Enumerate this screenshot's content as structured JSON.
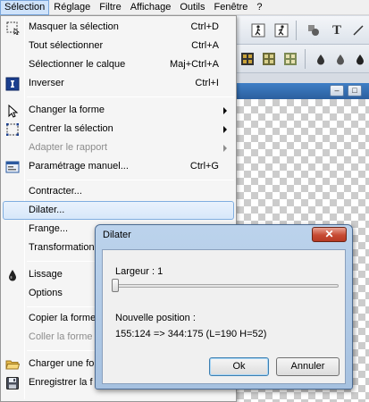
{
  "menubar": {
    "items": [
      "Sélection",
      "Réglage",
      "Filtre",
      "Affichage",
      "Outils",
      "Fenêtre",
      "?"
    ]
  },
  "menu": {
    "items": [
      {
        "label": "Masquer la sélection",
        "shortcut": "Ctrl+D",
        "icon": "dashed-selection-icon",
        "state": "normal"
      },
      {
        "label": "Tout sélectionner",
        "shortcut": "Ctrl+A",
        "icon": "",
        "state": "normal"
      },
      {
        "label": "Sélectionner le calque",
        "shortcut": "Maj+Ctrl+A",
        "icon": "",
        "state": "normal"
      },
      {
        "label": "Inverser",
        "shortcut": "Ctrl+I",
        "icon": "invert-icon",
        "state": "normal"
      },
      {
        "label": "Changer la forme",
        "shortcut": "",
        "icon": "pointer-icon",
        "state": "submenu"
      },
      {
        "label": "Centrer la sélection",
        "shortcut": "",
        "icon": "center-selection-icon",
        "state": "submenu"
      },
      {
        "label": "Adapter le rapport",
        "shortcut": "",
        "icon": "",
        "state": "disabled-submenu"
      },
      {
        "label": "Paramétrage manuel...",
        "shortcut": "Ctrl+G",
        "icon": "window-settings-icon",
        "state": "normal"
      },
      {
        "label": "Contracter...",
        "shortcut": "",
        "icon": "",
        "state": "normal"
      },
      {
        "label": "Dilater...",
        "shortcut": "",
        "icon": "",
        "state": "highlighted"
      },
      {
        "label": "Frange...",
        "shortcut": "",
        "icon": "",
        "state": "normal"
      },
      {
        "label": "Transformation",
        "shortcut": "",
        "icon": "",
        "state": "normal"
      },
      {
        "label": "Lissage",
        "shortcut": "",
        "icon": "droplet-icon",
        "state": "normal"
      },
      {
        "label": "Options",
        "shortcut": "",
        "icon": "",
        "state": "normal"
      },
      {
        "label": "Copier la forme",
        "shortcut": "",
        "icon": "",
        "state": "normal"
      },
      {
        "label": "Coller la forme",
        "shortcut": "",
        "icon": "",
        "state": "disabled"
      },
      {
        "label": "Charger une fo",
        "shortcut": "",
        "icon": "folder-open-icon",
        "state": "normal"
      },
      {
        "label": "Enregistrer la f",
        "shortcut": "",
        "icon": "save-disk-icon",
        "state": "normal"
      }
    ]
  },
  "dialog": {
    "title": "Dilater",
    "close_label": "✕",
    "width_label": "Largeur : 1",
    "slider_value": 1,
    "new_position_label": "Nouvelle position :",
    "new_position_value": "155:124 => 344:175 (L=190  H=52)",
    "ok_label": "Ok",
    "cancel_label": "Annuler"
  },
  "toolbar": {
    "text_tool_glyph": "T",
    "minimize_glyph": "–",
    "maximize_glyph": "□"
  }
}
